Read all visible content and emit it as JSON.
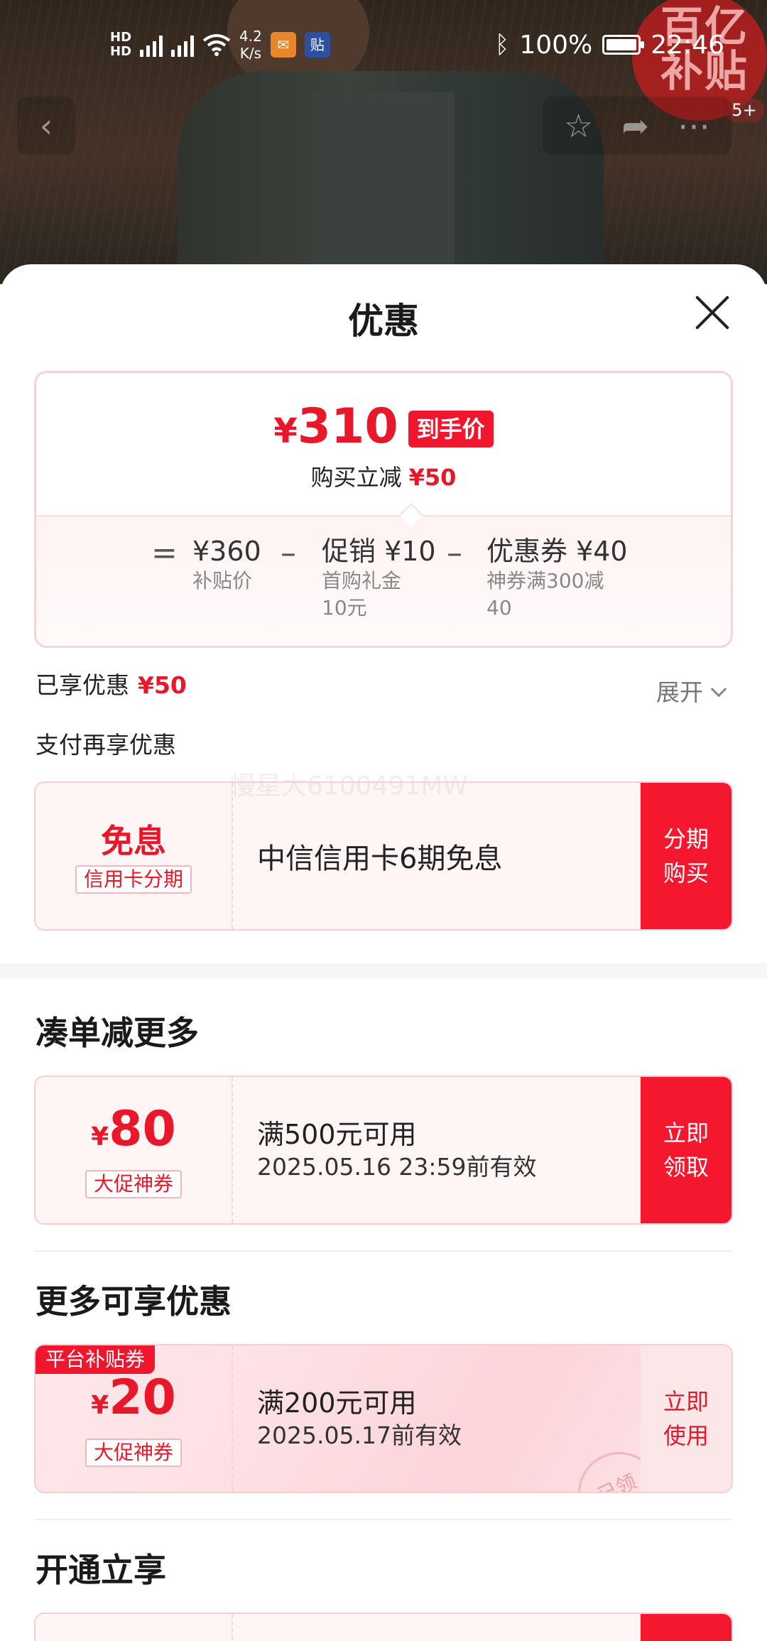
{
  "status_bar": {
    "hd1": "HD",
    "hd2": "HD",
    "net_speed_value": "4.2",
    "net_speed_unit": "K/s",
    "app_badge_2": "贴",
    "battery": "100%",
    "time": "22:46"
  },
  "sticker": {
    "text": "百亿补贴",
    "badge": "5+"
  },
  "sheet": {
    "title": "优惠"
  },
  "price_card": {
    "currency": "¥",
    "final_price": "310",
    "final_tag": "到手价",
    "instant_label": "购买立减",
    "instant_value": "¥50",
    "equals": "=",
    "minus": "–",
    "base": {
      "value": "¥360",
      "label": "补贴价"
    },
    "promo": {
      "value": "促销 ¥10",
      "label_line1": "首购礼金",
      "label_line2": "10元"
    },
    "coupon": {
      "value": "优惠券 ¥40",
      "label_line1": "神券满300减",
      "label_line2": "40"
    }
  },
  "enjoyed": {
    "label": "已享优惠",
    "value": "¥50",
    "expand": "展开"
  },
  "pay_section": {
    "label": "支付再享优惠",
    "watermark": "慢星大6100491MW",
    "card": {
      "title": "免息",
      "tag": "信用卡分期",
      "desc": "中信信用卡6期免息",
      "cta": "分期购买"
    }
  },
  "bundle_section": {
    "title": "凑单减更多",
    "coupon": {
      "currency": "¥",
      "amount": "80",
      "tag": "大促神券",
      "condition": "满500元可用",
      "validity": "2025.05.16 23:59前有效",
      "cta": "立即领取"
    }
  },
  "more_section": {
    "title": "更多可享优惠",
    "coupon": {
      "corner_tag": "平台补贴券",
      "currency": "¥",
      "amount": "20",
      "tag": "大促神券",
      "condition": "满200元可用",
      "validity": "2025.05.17前有效",
      "cta": "立即使用",
      "stamp": "已领"
    }
  },
  "open_section": {
    "title": "开通立享"
  },
  "colors": {
    "accent_red": "#f0162e",
    "price_red": "#e8182a",
    "card_border": "#f6d3d5"
  }
}
